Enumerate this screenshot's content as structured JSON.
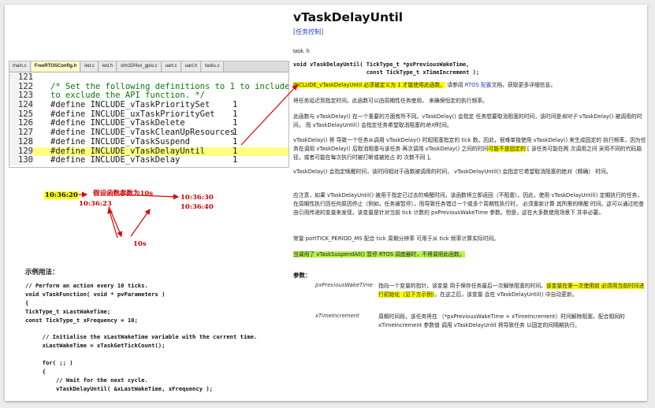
{
  "editor": {
    "tabs": [
      "main.c",
      "FreeRTOSConfig.h",
      "led.c",
      "led.h",
      "stm32f4xx_gpio.c",
      "uart.c",
      "uart.h",
      "tasks.c"
    ],
    "active_tab": "FreeRTOSConfig.h",
    "lines": [
      {
        "num": "121",
        "text": "",
        "value": "",
        "comment": false,
        "highlight": false
      },
      {
        "num": "122",
        "text": "/* Set the following definitions to 1 to include the",
        "value": "",
        "comment": true,
        "highlight": false
      },
      {
        "num": "123",
        "text": "to exclude the API function. */",
        "value": "",
        "comment": true,
        "highlight": false
      },
      {
        "num": "124",
        "text": "#define INCLUDE_vTaskPrioritySet",
        "value": "1",
        "comment": false,
        "highlight": false
      },
      {
        "num": "125",
        "text": "#define INCLUDE_uxTaskPriorityGet",
        "value": "1",
        "comment": false,
        "highlight": false
      },
      {
        "num": "126",
        "text": "#define INCLUDE_vTaskDelete",
        "value": "1",
        "comment": false,
        "highlight": false
      },
      {
        "num": "127",
        "text": "#define INCLUDE_vTaskCleanUpResources",
        "value": "1",
        "comment": false,
        "highlight": false
      },
      {
        "num": "128",
        "text": "#define INCLUDE_vTaskSuspend",
        "value": "1",
        "comment": false,
        "highlight": false
      },
      {
        "num": "129",
        "text": "#define INCLUDE_vTaskDelayUntil",
        "value": "1",
        "comment": false,
        "highlight": true
      },
      {
        "num": "130",
        "text": "#define INCLUDE_vTaskDelay",
        "value": "1",
        "comment": false,
        "highlight": false
      }
    ]
  },
  "diagram": {
    "t1": "10:36:20",
    "t2": "10:36:23",
    "t3": "10:36:30",
    "t4": "10:36:40",
    "caption": "假设函数参数为10s",
    "period": "10s"
  },
  "example": {
    "title": "示例用法：",
    "lines": [
      "// Perform an action every 10 ticks.",
      "void vTaskFunction( void * pvParameters )",
      "{",
      "TickType_t xLastWakeTime;",
      "const TickType_t xFrequency = 10;",
      "",
      "     // Initialise the xLastWakeTime variable with the current time.",
      "     xLastWakeTime = xTaskGetTickCount();",
      "",
      "     for( ;; )",
      "     {",
      "         // Wait for the next cycle.",
      "         vTaskDelayUntil( &xLastWakeTime, xFrequency );",
      "",
      "         // Perform action here.",
      "     }",
      "}"
    ]
  },
  "doc": {
    "title": "vTaskDelayUntil",
    "link": "[任务控制]",
    "task_h": "task. h",
    "signature": "void vTaskDelayUntil( TickType_t *pxPreviousWakeTime,\n                      const TickType_t xTimeIncrement );",
    "p1_hl": "INCLUDE_vTaskDelayUntil 必须被定义为 1 才能使用此函数。",
    "p1_a": " 请参阅 ",
    "p1_link": "RTOS 配置",
    "p1_b": "文档，获取更多详细信息。",
    "p2": "将任务延迟到指定时间。此函数可以由周期性任务使用， 来确保恒定的执行频率。",
    "p3_a": "此函数与 vTaskDelay() 在一个重要的方面有所不同。vTaskDelay() 会指定 任务想要取消阻塞的时间，该时间是",
    "p3_em1": "相对于",
    "p3_b": " vTaskDelay() 被调用的时间， 而 vTaskDelayUntil() 会指定任务希望取消阻塞的",
    "p3_em2": "绝对",
    "p3_c": "时间。",
    "p4_a": "vTaskDelay() 将 导致一个任务从调用 vTaskDelay() 时起阻塞指定的 tick 数。因此，很难单独使用 vTaskDelay() 来生成固定的 执行频率，因为任务在调用 vTaskDelay() 后取消阻塞与该任务 再次调用 vTaskDelay() 之间的时间",
    "p4_hl": "可能不是固定的",
    "p4_b": " [ 该任务可能在两 次调用之间 采用不同的代码路径，或者可能在每次执行时被打断或被抢占 的 次数不同 ]。",
    "p5": "vTaskDelay() 会指定唤醒时间，该时间相对于函数被调用的时间， vTaskDelayUntil() 会指定它希望取消阻塞的绝对（精确） 时间。",
    "p6": "应注意，如果 vTaskDelayUntil() 被用于指定已过去的唤醒时间，该函数将立即返回（不阻塞）。因此，使用 vTaskDelayUntil() 定期执行的任务，在周期性执行因任何原因停止（例如，任务被暂停），而导致任务错过一个或多个周期性执行时， 必须重新计算 其所需的唤醒 时间。这可以通过检查由引用传递的变量来发现，该变量是针对当前 tick 计数的 pxPreviousWakeTime 参数。但是，这在大多数使用场景下 并非必要。",
    "p7": "常量 portTICK_PERIOD_MS 配合 tick 周期分辨率 可用于从 tick 频率计算实际时间。",
    "p8_hl": "当调用了 vTaskSuspendAll() 暂停 RTOS 调度器时，不得调用此函数。",
    "params_title": "参数：",
    "param1_name": "pxPreviousWakeTime",
    "param1_a": "指向一个变量的指针，该变量 用于保存任务最后一次解除阻塞的时间。",
    "param1_hl": "该变量在第一次使用前 必须用当前时间进行初始化（见下方示例）",
    "param1_b": "。在这之后，该变量 会在 vTaskDelayUntil() 中自动更新。",
    "param2_name": "xTimeIncrement",
    "param2": "周期时间段。该任务将在 （*pxPreviousWakeTime + xTimeIncrement）时间解除阻塞。配合相同的 xTimeIncrement 参数值 调用 vTaskDelayUntil 将导致任务 以固定的间隔期执行。"
  },
  "colors": {
    "highlight_yellow": "#ffff00",
    "highlight_green": "#b4f24a",
    "annotation_red": "#e00000",
    "link_blue": "#1a3ec8"
  }
}
